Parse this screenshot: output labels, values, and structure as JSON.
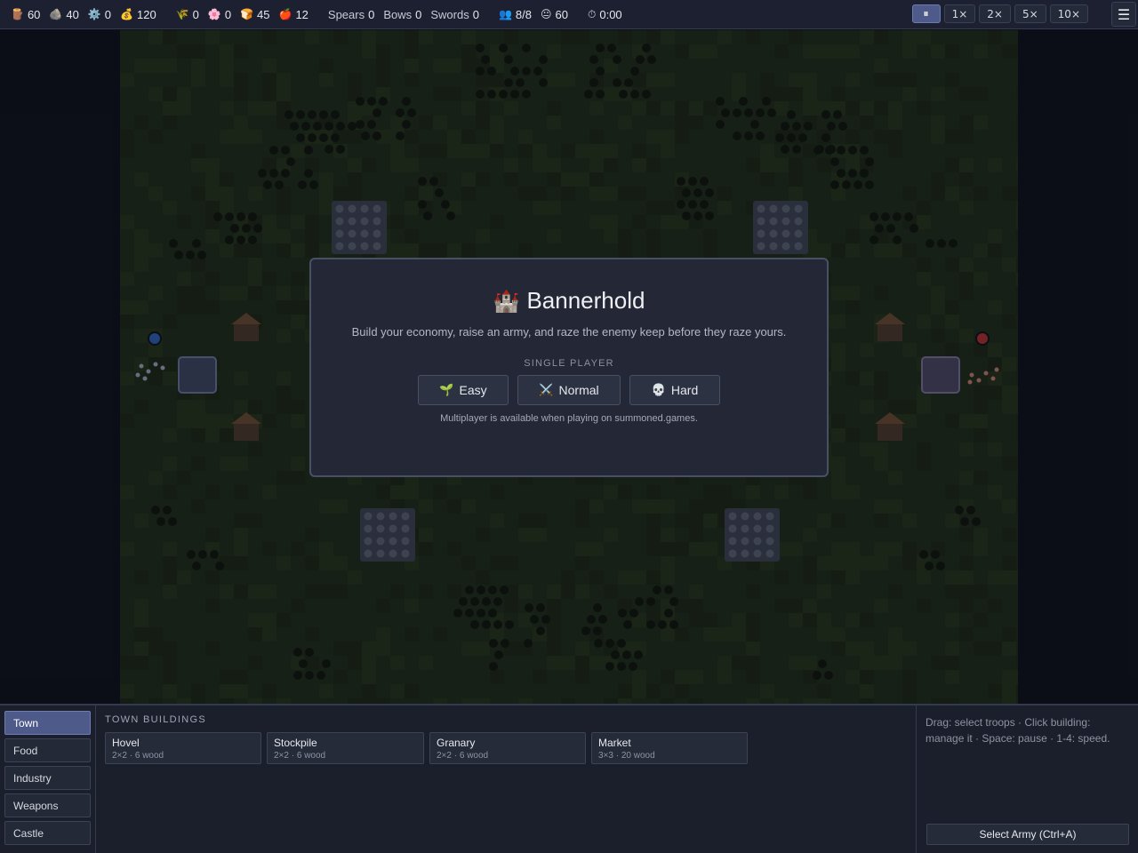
{
  "topbar": {
    "resources": [
      {
        "icon": "🪵",
        "name": "wood-icon",
        "value": "60"
      },
      {
        "icon": "🪨",
        "name": "stone-icon",
        "value": "40"
      },
      {
        "icon": "⚙️",
        "name": "iron-icon",
        "value": "0"
      },
      {
        "icon": "💰",
        "name": "gold-icon",
        "value": "120"
      }
    ],
    "food": [
      {
        "icon": "🌾",
        "name": "wheat-icon",
        "value": "0"
      },
      {
        "icon": "🌸",
        "name": "flower-icon",
        "value": "0"
      },
      {
        "icon": "🍞",
        "name": "bread-icon",
        "value": "45"
      },
      {
        "icon": "🍎",
        "name": "apple-icon",
        "value": "12"
      }
    ],
    "weapons": [
      {
        "label": "Spears",
        "value": "0"
      },
      {
        "label": "Bows",
        "value": "0"
      },
      {
        "label": "Swords",
        "value": "0"
      }
    ],
    "population": {
      "icon": "👥",
      "value": "8/8"
    },
    "happiness": {
      "icon": "😐",
      "value": "60"
    },
    "timer": {
      "icon": "⏱",
      "value": "0:00"
    },
    "speeds": [
      "⏸",
      "1×",
      "2×",
      "5×",
      "10×"
    ],
    "speed_active": 0,
    "menu_icon": "☰"
  },
  "modal": {
    "title_icon": "🏰",
    "title": "Bannerhold",
    "subtitle": "Build your economy, raise an army, and raze the enemy keep before they raze yours.",
    "section": "SINGLE PLAYER",
    "difficulties": [
      {
        "icon": "🌱",
        "label": "Easy"
      },
      {
        "icon": "⚔️",
        "label": "Normal"
      },
      {
        "icon": "💀",
        "label": "Hard"
      }
    ],
    "note": "Multiplayer is available when playing on summoned.games."
  },
  "bottom": {
    "categories": [
      "Town",
      "Food",
      "Industry",
      "Weapons",
      "Castle"
    ],
    "active_category": 0,
    "heading": "TOWN BUILDINGS",
    "buildings": [
      {
        "name": "Hovel",
        "info": "2×2 · 6 wood"
      },
      {
        "name": "Stockpile",
        "info": "2×2 · 6 wood"
      },
      {
        "name": "Granary",
        "info": "2×2 · 6 wood"
      },
      {
        "name": "Market",
        "info": "3×3 · 20 wood"
      }
    ],
    "help": "Drag: select troops · Click building: manage it · Space: pause · 1-4: speed.",
    "army_button": "Select Army (Ctrl+A)"
  },
  "colors": {
    "accent": "#4d5a8a",
    "grass": "#1f2b18",
    "tree": "#0f150c",
    "player_blue": "#2e5fb0",
    "enemy_red": "#b02e2e"
  }
}
